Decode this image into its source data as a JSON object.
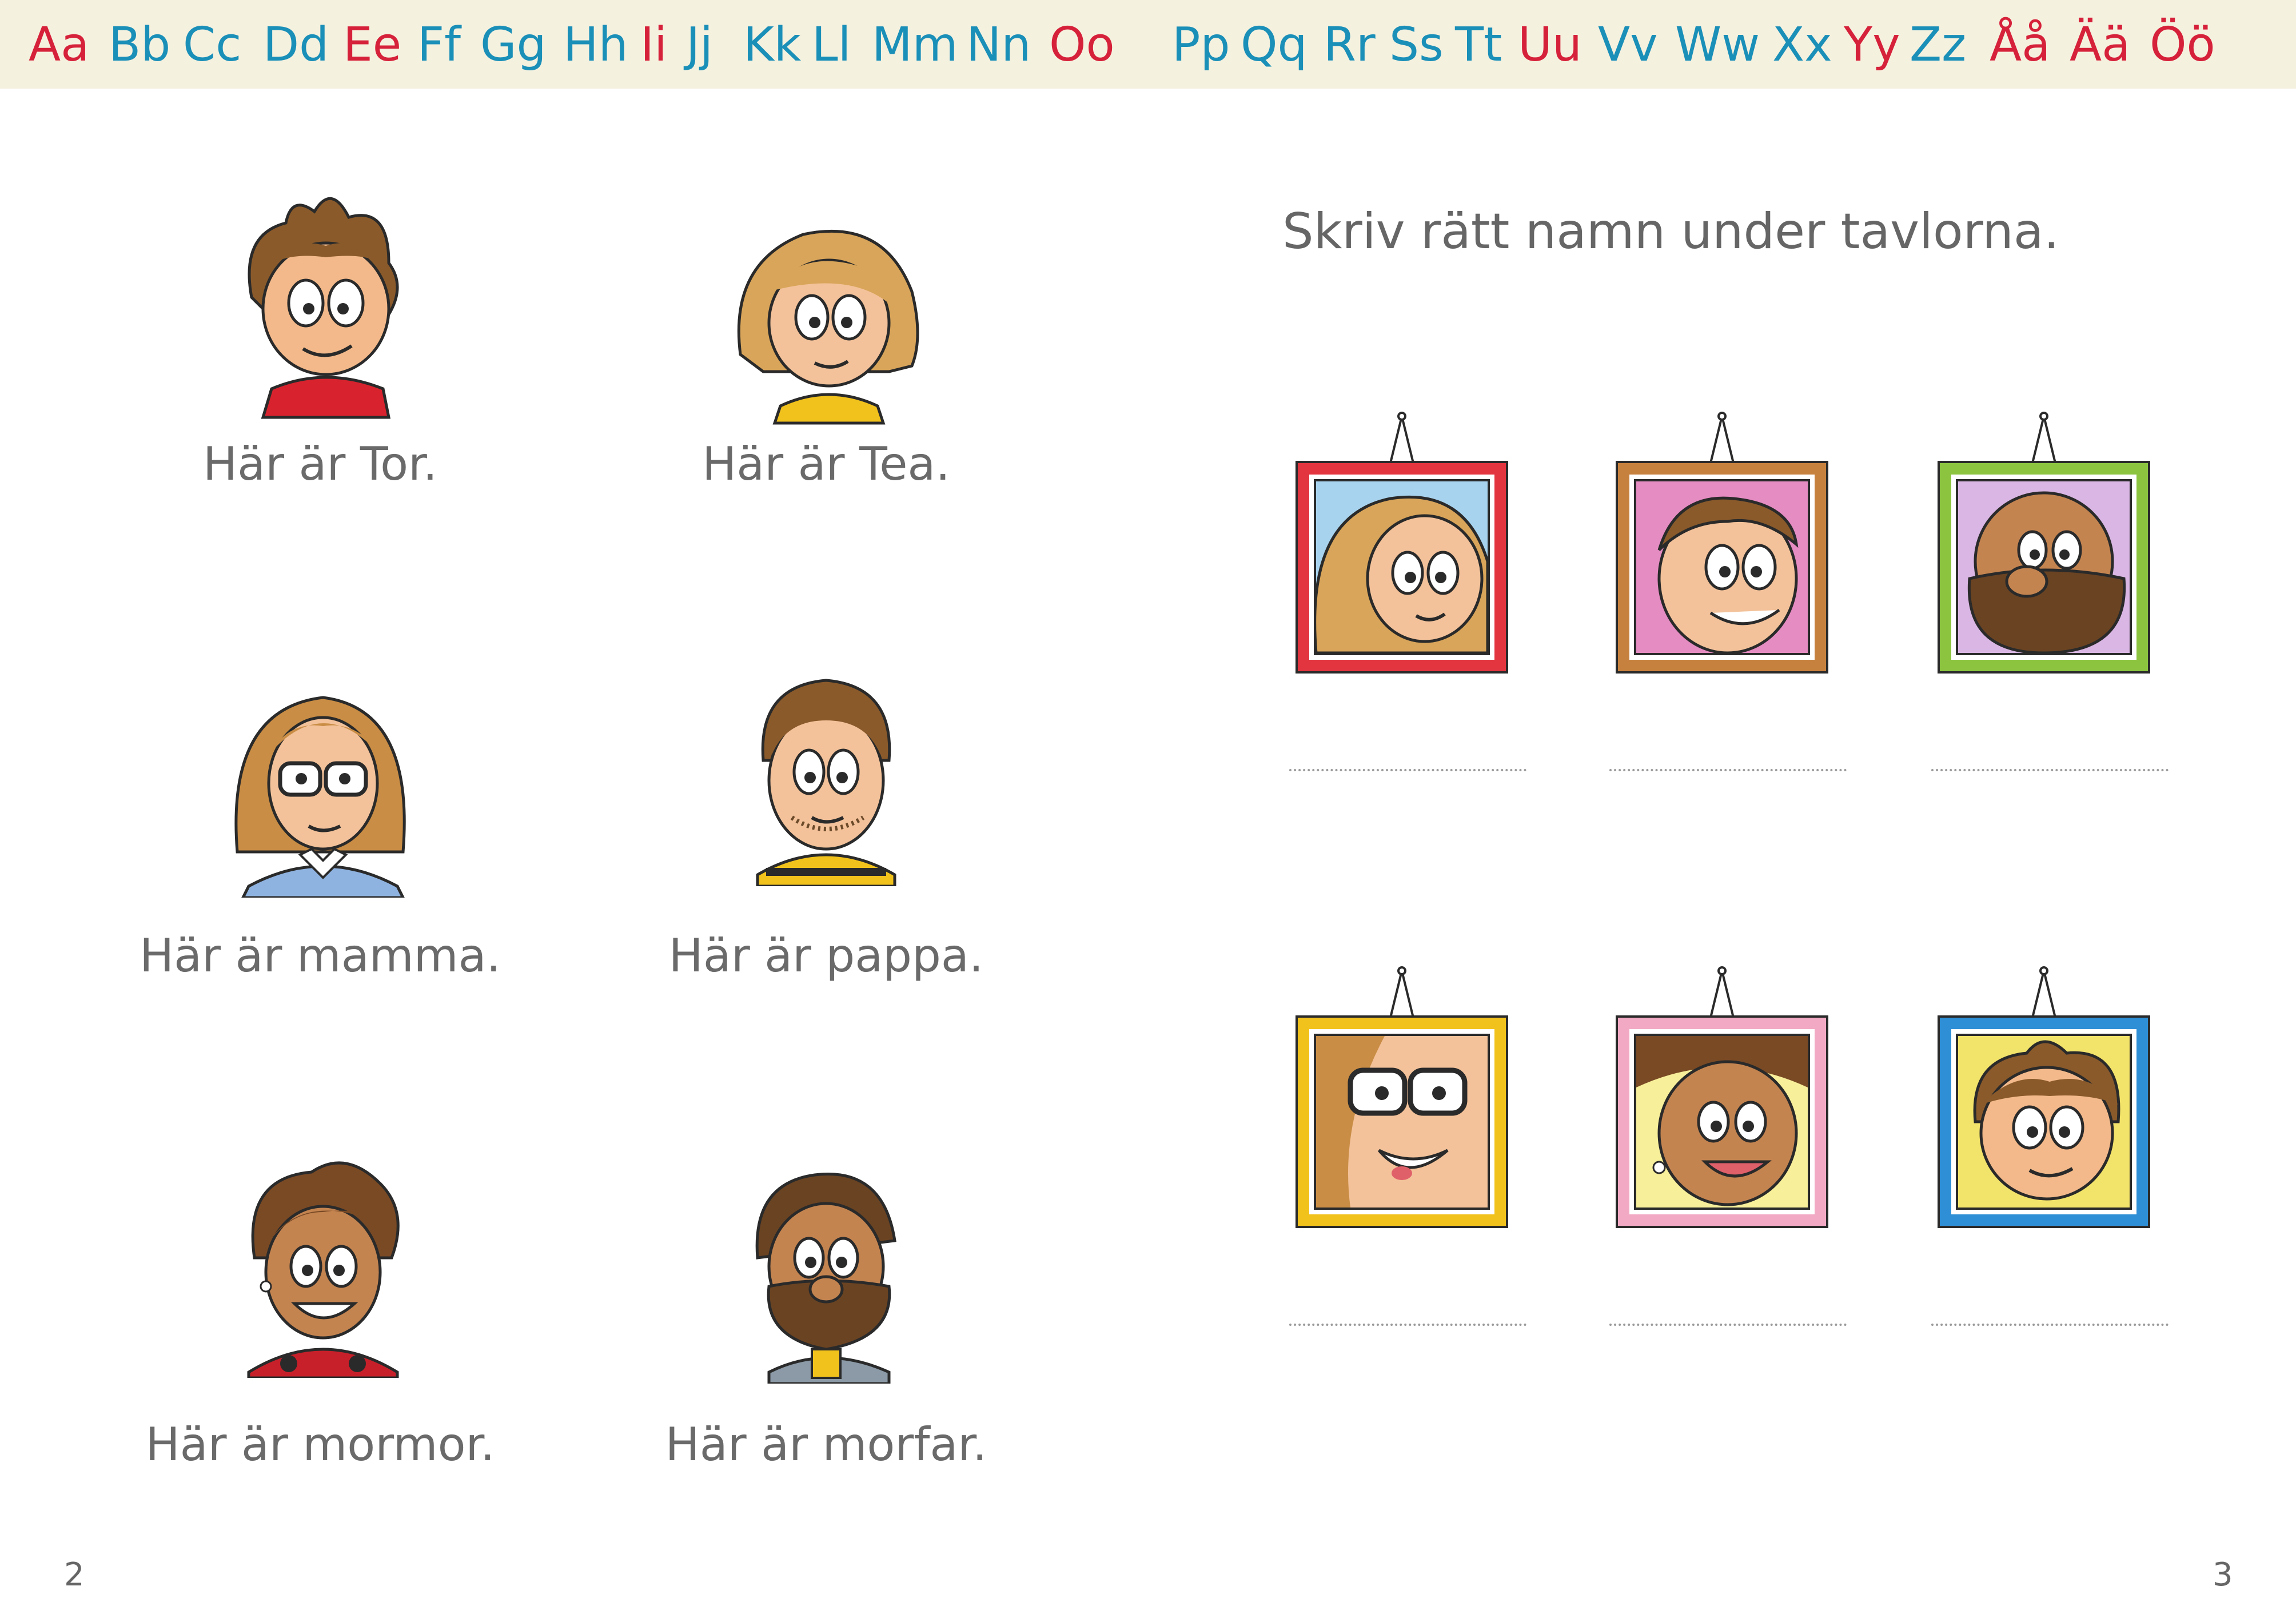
{
  "alphabet": [
    "Aa",
    "Bb",
    "Cc",
    "Dd",
    "Ee",
    "Ff",
    "Gg",
    "Hh",
    "Ii",
    "Jj",
    "Kk",
    "Ll",
    "Mm",
    "Nn",
    "Oo",
    "Pp",
    "Qq",
    "Rr",
    "Ss",
    "Tt",
    "Uu",
    "Vv",
    "Ww",
    "Xx",
    "Yy",
    "Zz",
    "Åå",
    "Ää",
    "Öö"
  ],
  "vowels": [
    "Aa",
    "Ee",
    "Ii",
    "Oo",
    "Uu",
    "Yy",
    "Åå",
    "Ää",
    "Öö"
  ],
  "colors": {
    "vowel": "#d6213a",
    "consonant": "#1a8fb8",
    "bar": "#f5f1df"
  },
  "left_page": {
    "page_number": "2",
    "captions": [
      {
        "id": "tor",
        "text": "Här är Tor."
      },
      {
        "id": "tea",
        "text": "Här är Tea."
      },
      {
        "id": "mamma",
        "text": "Här är mamma."
      },
      {
        "id": "pappa",
        "text": "Här är pappa."
      },
      {
        "id": "mormor",
        "text": "Här är mormor."
      },
      {
        "id": "morfar",
        "text": "Här är morfar."
      }
    ]
  },
  "right_page": {
    "page_number": "3",
    "instruction": "Skriv rätt namn under tavlorna.",
    "frames": [
      {
        "color": "#e2353f",
        "face": "tea"
      },
      {
        "color": "#c7813f",
        "face": "pappa"
      },
      {
        "color": "#8cc440",
        "face": "morfar"
      },
      {
        "color": "#f2c21c",
        "face": "mamma"
      },
      {
        "color": "#f2a9c3",
        "face": "mormor"
      },
      {
        "color": "#2f8fd6",
        "face": "tor"
      }
    ]
  }
}
